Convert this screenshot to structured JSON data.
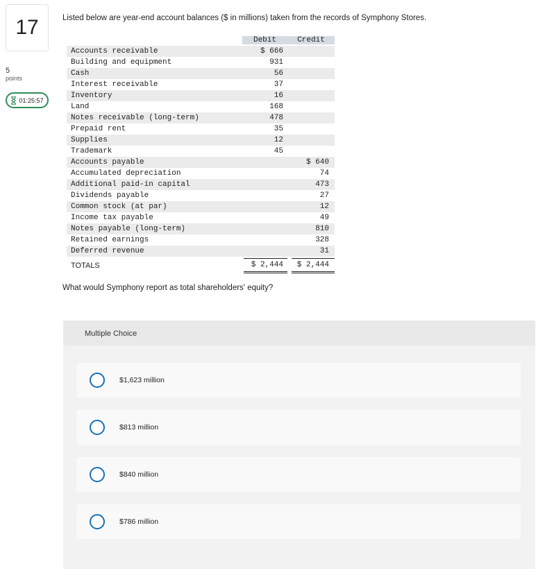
{
  "question": {
    "number": "17",
    "points_value": "5",
    "points_label": "points",
    "timer": "01:25:57",
    "prompt": "Listed below are year-end account balances ($ in millions) taken from the records of Symphony Stores.",
    "text": "What would Symphony report as total shareholders' equity?"
  },
  "ledger": {
    "headers": {
      "account": "",
      "debit": "Debit",
      "credit": "Credit"
    },
    "rows": [
      {
        "account": "Accounts receivable",
        "debit": "$ 666",
        "credit": ""
      },
      {
        "account": "Building and equipment",
        "debit": "931",
        "credit": ""
      },
      {
        "account": "Cash",
        "debit": "56",
        "credit": ""
      },
      {
        "account": "Interest receivable",
        "debit": "37",
        "credit": ""
      },
      {
        "account": "Inventory",
        "debit": "16",
        "credit": ""
      },
      {
        "account": "Land",
        "debit": "168",
        "credit": ""
      },
      {
        "account": "Notes receivable (long-term)",
        "debit": "478",
        "credit": ""
      },
      {
        "account": "Prepaid rent",
        "debit": "35",
        "credit": ""
      },
      {
        "account": "Supplies",
        "debit": "12",
        "credit": ""
      },
      {
        "account": "Trademark",
        "debit": "45",
        "credit": ""
      },
      {
        "account": "Accounts payable",
        "debit": "",
        "credit": "$ 640"
      },
      {
        "account": "Accumulated depreciation",
        "debit": "",
        "credit": "74"
      },
      {
        "account": "Additional paid-in capital",
        "debit": "",
        "credit": "473"
      },
      {
        "account": "Dividends payable",
        "debit": "",
        "credit": "27"
      },
      {
        "account": "Common stock (at par)",
        "debit": "",
        "credit": "12"
      },
      {
        "account": "Income tax payable",
        "debit": "",
        "credit": "49"
      },
      {
        "account": "Notes payable (long-term)",
        "debit": "",
        "credit": "810"
      },
      {
        "account": "Retained earnings",
        "debit": "",
        "credit": "328"
      },
      {
        "account": "Deferred revenue",
        "debit": "",
        "credit": "31"
      }
    ],
    "totals": {
      "label": "TOTALS",
      "debit": "$ 2,444",
      "credit": "$ 2,444"
    }
  },
  "multiple_choice": {
    "header": "Multiple Choice",
    "options": [
      {
        "label": "$1,623 million"
      },
      {
        "label": "$813 million"
      },
      {
        "label": "$840 million"
      },
      {
        "label": "$786 million"
      }
    ]
  },
  "colors": {
    "timer_border": "#2e8b57",
    "radio_border": "#1a6fb4",
    "table_header_bg": "#d6dbe3",
    "row_stripe": "#ebebeb",
    "panel_bg": "#f2f2f2"
  },
  "icons": {
    "timer": "hourglass-icon"
  }
}
